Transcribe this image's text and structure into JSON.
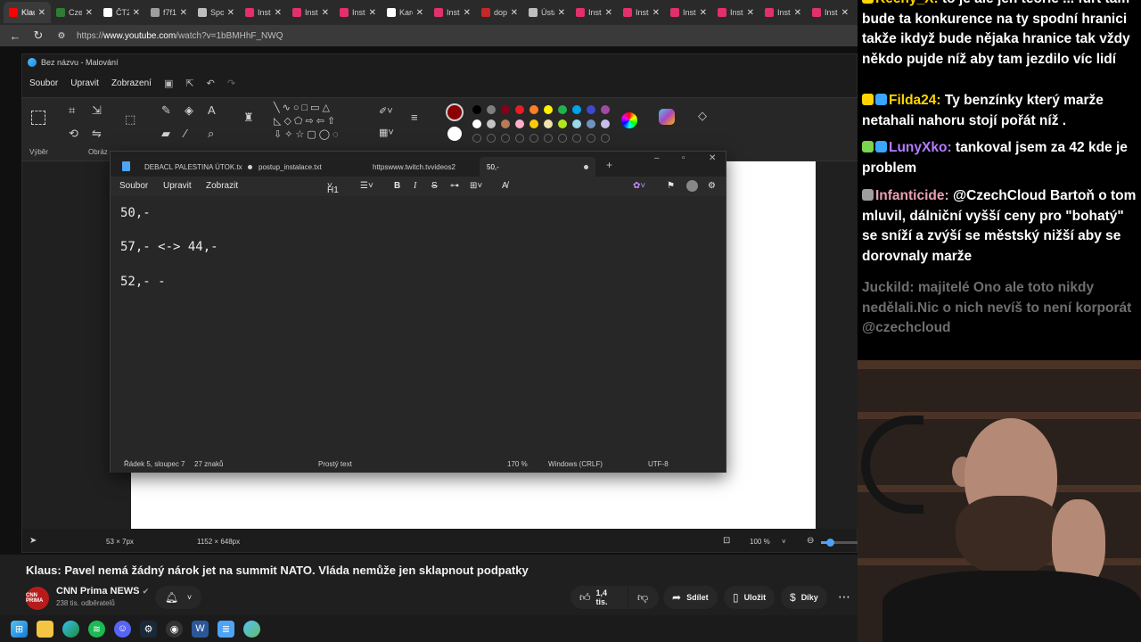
{
  "browser": {
    "tabs": [
      {
        "label": "Klau",
        "color": "#ff0000"
      },
      {
        "label": "Cze",
        "color": "#2e7d32"
      },
      {
        "label": "ČT24",
        "color": "#ffffff"
      },
      {
        "label": "f7f1",
        "color": "#9e9e9e"
      },
      {
        "label": "Spor",
        "color": "#bdbdbd"
      },
      {
        "label": "Insta",
        "color": "#e1306c"
      },
      {
        "label": "Insta",
        "color": "#e1306c"
      },
      {
        "label": "Insta",
        "color": "#e1306c"
      },
      {
        "label": "Kare",
        "color": "#ffffff"
      },
      {
        "label": "Insta",
        "color": "#e1306c"
      },
      {
        "label": "dop",
        "color": "#c62828"
      },
      {
        "label": "Ústa",
        "color": "#bdbdbd"
      },
      {
        "label": "Insta",
        "color": "#e1306c"
      },
      {
        "label": "Insta",
        "color": "#e1306c"
      },
      {
        "label": "Insta",
        "color": "#e1306c"
      },
      {
        "label": "Insta",
        "color": "#e1306c"
      },
      {
        "label": "Insta",
        "color": "#e1306c"
      },
      {
        "label": "Inst",
        "color": "#e1306c"
      }
    ],
    "url_prefix": "https://",
    "url_host": "www.youtube.com",
    "url_rest": "/watch?v=1bBMHhF_NWQ"
  },
  "paint": {
    "title": "Bez názvu - Malování",
    "menu": [
      "Soubor",
      "Upravit",
      "Zobrazení"
    ],
    "ribbon_labels": {
      "select": "Výběr",
      "image": "Obráz"
    },
    "status": {
      "cursor": "53 × 7px",
      "size": "1152 × 648px",
      "zoom": "100 %"
    },
    "palette": {
      "primary": "#8b0000",
      "secondary": "#ffffff",
      "row1": [
        "#000000",
        "#7f7f7f",
        "#880015",
        "#ed1c24",
        "#ff7f27",
        "#fff200",
        "#22b14c",
        "#00a2e8",
        "#3f48cc",
        "#a349a4"
      ],
      "row2": [
        "#ffffff",
        "#c3c3c3",
        "#b97a57",
        "#ffaec9",
        "#ffc90e",
        "#efe4b0",
        "#b5e61d",
        "#99d9ea",
        "#7092be",
        "#c8bfe7"
      ]
    }
  },
  "notepad": {
    "tabs": [
      {
        "label": "DEBACL PALESTINA ÚTOK.tx",
        "dot": true
      },
      {
        "label": "postup_instalace.txt",
        "dot": false
      },
      {
        "label": "httpswww.twitch.tvvideos2",
        "dot": false
      },
      {
        "label": "50,-",
        "dot": true
      }
    ],
    "menu": [
      "Soubor",
      "Upravit",
      "Zobrazit"
    ],
    "heading_select": "H1",
    "lines": [
      "50,-",
      "57,- <-> 44,-",
      "52,- -"
    ],
    "status": {
      "position": "Řádek 5, sloupec 7",
      "chars": "27 znaků",
      "format": "Prostý text",
      "zoom": "170 %",
      "eol": "Windows (CRLF)",
      "encoding": "UTF-8"
    }
  },
  "youtube": {
    "title": "Klaus: Pavel nemá žádný nárok jet na summit NATO. Vláda nemůže jen sklapnout podpatky",
    "channel": "CNN Prima NEWS",
    "subscribers": "238 tis. odběratelů",
    "likes": "1,4 tis.",
    "share": "Sdílet",
    "save": "Uložit",
    "thanks": "Díky",
    "avatar_text": "CNN PRIMA"
  },
  "chat": [
    {
      "user": "Keeny_X",
      "user_color": "#ffd400",
      "text": "to je ale jen teorie ... furt tam bude ta konkurence na ty spodní hranici takže ikdyž bude nějaka hranice tak vždy někdo pujde níž aby tam jezdilo víc lidí",
      "badges": [
        "#ffd400"
      ],
      "dim": false
    },
    {
      "user": "Filda24",
      "user_color": "#ffd400",
      "text": "Ty benzínky který marže netahali nahoru stojí pořát níž .",
      "badges": [
        "#ffd400",
        "#3aa6ff"
      ],
      "dim": false
    },
    {
      "user": "LunyXko",
      "user_color": "#b57bff",
      "text": "tankoval jsem za 42 kde je problem",
      "badges": [
        "#7bd34f",
        "#3aa6ff"
      ],
      "dim": false
    },
    {
      "user": "Infanticide",
      "user_color": "#e8a0b4",
      "text": "@CzechCloud Bartoň o tom mluvil, dálniční vyšší ceny pro \"bohatý\" se sníží a zvýší se městský nižší aby se dorovnaly marže",
      "badges": [
        "#9e9e9e"
      ],
      "dim": false
    },
    {
      "user": "Juckild",
      "user_color": "#6e6e6e",
      "text": "majitelé Ono ale toto nikdy nedělali.Nic o nich nevíš to není korporát @czechcloud",
      "badges": [],
      "dim": true
    }
  ]
}
